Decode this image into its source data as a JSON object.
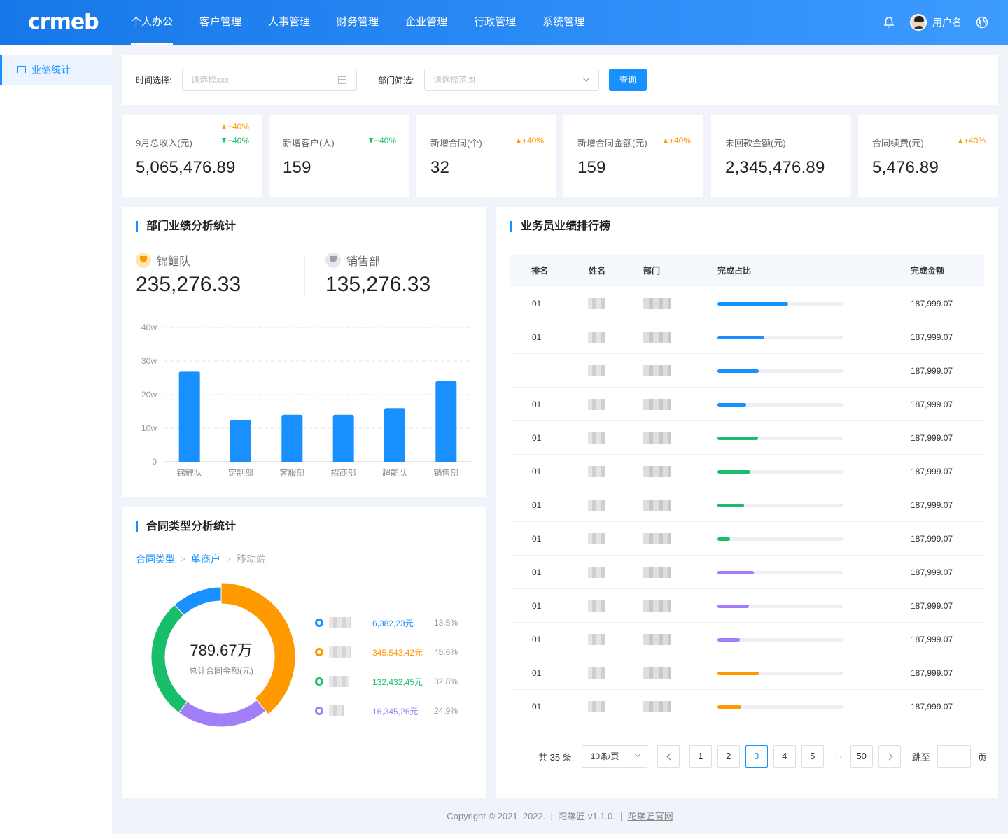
{
  "header": {
    "logo": "crmeb",
    "nav": [
      "个人办公",
      "客户管理",
      "人事管理",
      "财务管理",
      "企业管理",
      "行政管理",
      "系统管理"
    ],
    "active_nav": 0,
    "username": "用户名"
  },
  "sidebar": {
    "items": [
      {
        "label": "业绩统计"
      }
    ]
  },
  "filter": {
    "time_label": "时间选择:",
    "time_placeholder": "请选择xxx",
    "dept_label": "部门筛选:",
    "dept_placeholder": "请选择范围",
    "query_button": "查询"
  },
  "stats": [
    {
      "label": "9月总收入(元)",
      "value": "5,065,476.89",
      "trends": [
        {
          "dir": "up",
          "text": "+40%"
        },
        {
          "dir": "down",
          "text": "+40%"
        }
      ]
    },
    {
      "label": "新增客户(人)",
      "value": "159",
      "trends": [
        {
          "dir": "down",
          "text": "+40%"
        }
      ]
    },
    {
      "label": "新增合同(个)",
      "value": "32",
      "trends": [
        {
          "dir": "up",
          "text": "+40%"
        }
      ]
    },
    {
      "label": "新增合同金额(元)",
      "value": "159",
      "trends": [
        {
          "dir": "up",
          "text": "+40%"
        }
      ]
    },
    {
      "label": "未回款金额(元)",
      "value": "2,345,476.89",
      "trends": []
    },
    {
      "label": "合同续费(元)",
      "value": "5,476.89",
      "trends": [
        {
          "dir": "up",
          "text": "+40%"
        }
      ]
    }
  ],
  "dept_section": {
    "title": "部门业绩分析统计",
    "teams": [
      {
        "name": "锦鲤队",
        "value": "235,276.33",
        "medal": "gold"
      },
      {
        "name": "销售部",
        "value": "135,276.33",
        "medal": "silver"
      }
    ]
  },
  "chart_data": {
    "type": "bar",
    "categories": [
      "锦鲤队",
      "定制部",
      "客服部",
      "招商部",
      "超能队",
      "销售部"
    ],
    "values": [
      27,
      12.5,
      14,
      14,
      16,
      24
    ],
    "ylim": [
      0,
      40
    ],
    "yticks": [
      "0",
      "10w",
      "20w",
      "30w",
      "40w"
    ],
    "color": "#1890ff",
    "grid": true
  },
  "contract_section": {
    "title": "合同类型分析统计",
    "breadcrumb": [
      "合同类型",
      "单商户",
      "移动端"
    ],
    "total_value": "789.67万",
    "total_label": "总计合同金额(元)",
    "items": [
      {
        "amount": "6,382,23元",
        "percent": "13.5%",
        "color": "#1890ff",
        "share": 13.5
      },
      {
        "amount": "345,543,42元",
        "percent": "45.6%",
        "color": "#ff9900",
        "share": 45.6
      },
      {
        "amount": "132,432,45元",
        "percent": "32.8%",
        "color": "#19be6b",
        "share": 32.8
      },
      {
        "amount": "16,345,26元",
        "percent": "24.9%",
        "color": "#a27ef7",
        "share": 24.9
      }
    ]
  },
  "ranking": {
    "title": "业务员业绩排行榜",
    "columns": [
      "排名",
      "姓名",
      "部门",
      "完成占比",
      "完成金额"
    ],
    "rows": [
      {
        "rank": "01",
        "amount": "187,999.07",
        "progress": 0.56,
        "color": "#1890ff"
      },
      {
        "rank": "01",
        "amount": "187,999.07",
        "progress": 0.37,
        "color": "#1890ff"
      },
      {
        "rank": "",
        "amount": "187,999.07",
        "progress": 0.33,
        "color": "#1890ff"
      },
      {
        "rank": "01",
        "amount": "187,999.07",
        "progress": 0.23,
        "color": "#1890ff"
      },
      {
        "rank": "01",
        "amount": "187,999.07",
        "progress": 0.32,
        "color": "#19be6b"
      },
      {
        "rank": "01",
        "amount": "187,999.07",
        "progress": 0.26,
        "color": "#19be6b"
      },
      {
        "rank": "01",
        "amount": "187,999.07",
        "progress": 0.21,
        "color": "#19be6b"
      },
      {
        "rank": "01",
        "amount": "187,999.07",
        "progress": 0.1,
        "color": "#19be6b"
      },
      {
        "rank": "01",
        "amount": "187,999.07",
        "progress": 0.29,
        "color": "#a27ef7"
      },
      {
        "rank": "01",
        "amount": "187,999.07",
        "progress": 0.25,
        "color": "#a27ef7"
      },
      {
        "rank": "01",
        "amount": "187,999.07",
        "progress": 0.18,
        "color": "#a27ef7"
      },
      {
        "rank": "01",
        "amount": "187,999.07",
        "progress": 0.33,
        "color": "#ff9900"
      },
      {
        "rank": "01",
        "amount": "187,999.07",
        "progress": 0.19,
        "color": "#ff9900"
      }
    ],
    "pagination": {
      "total": "共 35 条",
      "page_size": "10条/页",
      "pages": [
        "1",
        "2",
        "3",
        "4",
        "5"
      ],
      "current": "3",
      "ellipsis": "···",
      "last": "50",
      "jump_label": "跳至",
      "page_suffix": "页"
    }
  },
  "footer": {
    "copyright": "Copyright © 2021–2022.",
    "version": "陀螺匠 v1.1.0.",
    "site_link": "陀螺匠官网",
    "separator": "|"
  }
}
